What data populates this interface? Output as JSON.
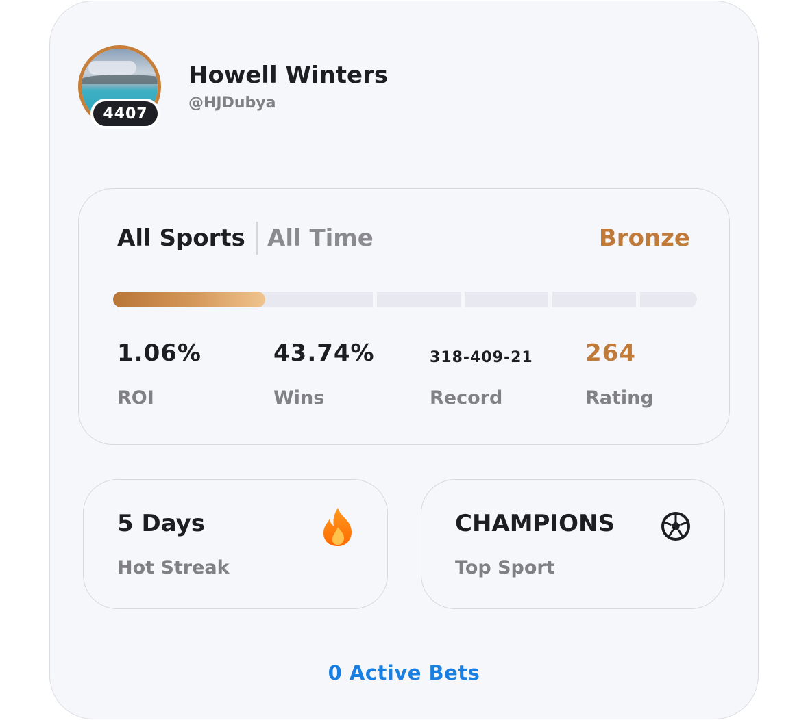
{
  "profile": {
    "name": "Howell Winters",
    "handle": "@HJDubya",
    "badge_number": "4407",
    "avatar_ring_color": "#c57f3b"
  },
  "stats_panel": {
    "filter_sport": "All Sports",
    "filter_period": "All Time",
    "tier": "Bronze",
    "tier_color": "#c07a3a",
    "progress_fraction": 0.26,
    "stats": [
      {
        "value": "1.06%",
        "label": "ROI"
      },
      {
        "value": "43.74%",
        "label": "Wins"
      },
      {
        "value": "318-409-21",
        "label": "Record"
      },
      {
        "value": "264",
        "label": "Rating"
      }
    ]
  },
  "tiles": {
    "streak": {
      "value": "5 Days",
      "label": "Hot Streak",
      "icon": "flame-icon"
    },
    "top_sport": {
      "value": "CHAMPIONS",
      "label": "Top Sport",
      "icon": "soccer-ball-icon"
    }
  },
  "footer": {
    "active_bets": "0 Active Bets",
    "link_color": "#1a7fe0"
  }
}
